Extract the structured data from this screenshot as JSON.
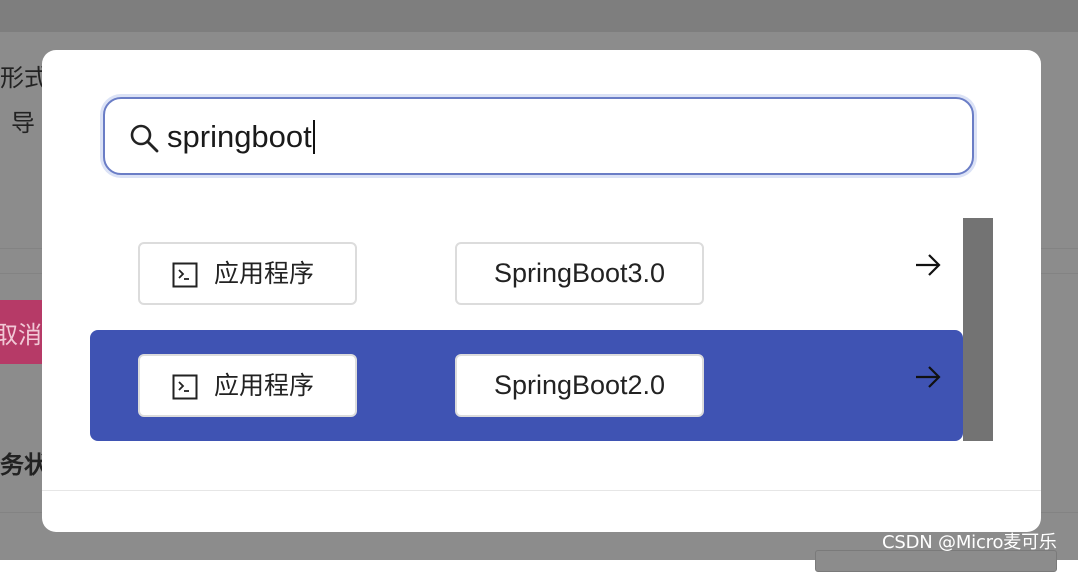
{
  "background": {
    "text_fragments": [
      {
        "text": "形式"
      },
      {
        "text": "导"
      },
      {
        "text": "取消"
      },
      {
        "text": "务状态"
      }
    ]
  },
  "search": {
    "value": "springboot",
    "placeholder": ""
  },
  "results": [
    {
      "type_icon": "terminal-icon",
      "type_label": "应用程序",
      "name": "SpringBoot3.0",
      "action_icon": "arrow-right-icon",
      "selected": false
    },
    {
      "type_icon": "terminal-icon",
      "type_label": "应用程序",
      "name": "SpringBoot2.0",
      "action_icon": "arrow-right-icon",
      "selected": true
    }
  ],
  "watermark": "CSDN @Micro麦可乐",
  "colors": {
    "accent": "#3f53b3",
    "search_border": "#6a7dc6",
    "overlay": "#8c8c8c",
    "background_button": "#b63a67"
  }
}
